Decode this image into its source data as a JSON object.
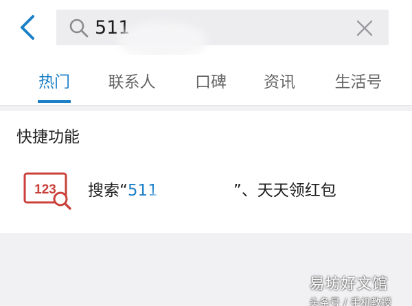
{
  "search": {
    "query": "511",
    "back_icon": "chevron-left-icon",
    "search_icon": "magnifier-icon",
    "clear_icon": "close-icon"
  },
  "tabs": [
    {
      "label": "热门",
      "active": true
    },
    {
      "label": "联系人",
      "active": false
    },
    {
      "label": "口碑",
      "active": false
    },
    {
      "label": "资讯",
      "active": false
    },
    {
      "label": "生活号",
      "active": false
    }
  ],
  "shortcuts": {
    "title": "快捷功能",
    "items": [
      {
        "icon": "number-search-icon",
        "icon_text": "123",
        "prefix": "搜索“",
        "keyword": "511",
        "suffix": "”、天天领红包"
      }
    ]
  },
  "watermark": {
    "title": "易坊好文馆",
    "subtitle": "头条号 / 手机教授"
  },
  "colors": {
    "accent": "#1a7fc7",
    "icon_red": "#c9413a",
    "background": "#f1f1f3"
  }
}
